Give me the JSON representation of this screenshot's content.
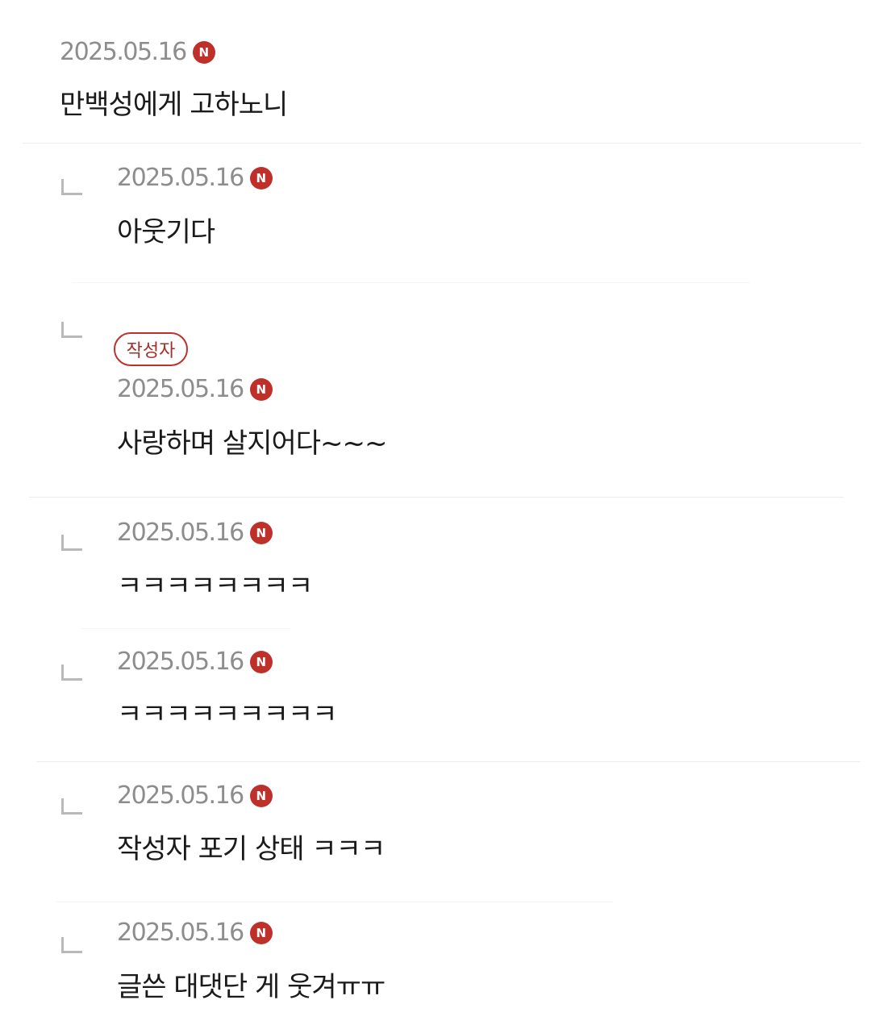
{
  "comments": [
    {
      "type": "root",
      "date": "2025.05.16",
      "badge": "N",
      "text": "만백성에게 고하노니"
    },
    {
      "type": "reply",
      "date": "2025.05.16",
      "badge": "N",
      "text": "아웃기다"
    },
    {
      "type": "reply",
      "author_tag": "작성자",
      "date": "2025.05.16",
      "badge": "N",
      "text": "사랑하며 살지어다~~~"
    },
    {
      "type": "reply",
      "date": "2025.05.16",
      "badge": "N",
      "text": "ㅋㅋㅋㅋㅋㅋㅋㅋ"
    },
    {
      "type": "reply",
      "date": "2025.05.16",
      "badge": "N",
      "text": "ㅋㅋㅋㅋㅋㅋㅋㅋㅋ"
    },
    {
      "type": "reply",
      "date": "2025.05.16",
      "badge": "N",
      "text": "작성자 포기 상태 ㅋㅋㅋ"
    },
    {
      "type": "reply",
      "date": "2025.05.16",
      "badge": "N",
      "text": "글쓴 대댓단 게 웃겨ㅠㅠ"
    }
  ],
  "colors": {
    "badge": "#c0302b",
    "date": "#8d8d8d",
    "reply_arrow": "#b9b9b9",
    "divider": "#ededed",
    "text": "#1a1a1a"
  },
  "icons": {
    "reply": "reply-arrow-icon",
    "new": "new-badge-icon"
  }
}
